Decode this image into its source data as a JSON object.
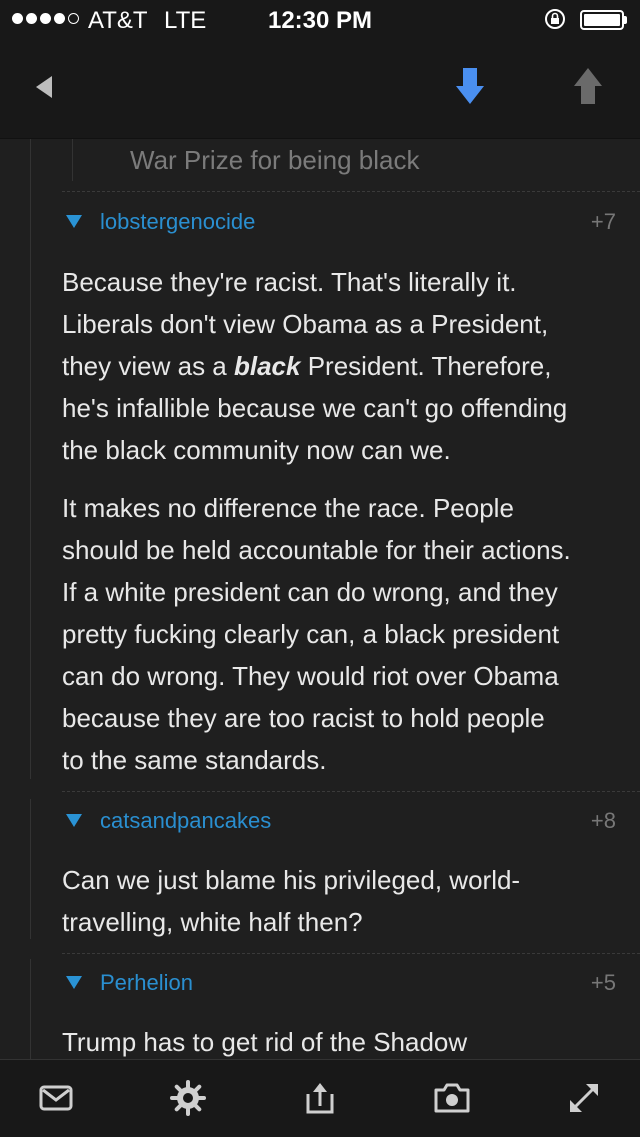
{
  "status": {
    "carrier": "AT&T",
    "network": "LTE",
    "time": "12:30 PM",
    "signal_bars": 4,
    "signal_max": 5
  },
  "nav": {
    "back_icon": "back-arrow-icon",
    "next_icon": "arrow-down-icon",
    "prev_icon": "arrow-up-icon",
    "accent": "#4a8ff0"
  },
  "previous_comment": {
    "text_tail": "War Prize for being black"
  },
  "comments": [
    {
      "username": "lobstergenocide",
      "score": "+7",
      "p1": {
        "l1": "Because they're racist. That's literally it.",
        "l2": "Liberals don't view Obama as a President,",
        "l3_pre": "they view as a ",
        "l3_em": "black",
        "l3_post": " President. Therefore,",
        "l4": "he's infallible because we can't go offending",
        "l5": "the black community now can we."
      },
      "p2": [
        "It makes no difference the race. People",
        "should be held accountable for their actions.",
        "If a white president can do wrong, and they",
        "pretty fucking clearly can, a black president",
        "can do wrong. They would riot over Obama",
        "because they are too racist to hold people",
        "to the same standards."
      ]
    },
    {
      "username": "catsandpancakes",
      "score": "+8",
      "lines": [
        "Can we just blame his privileged, world-",
        "travelling, white half then?"
      ]
    },
    {
      "username": "Perhelion",
      "score": "+5",
      "lines": [
        "Trump has to get rid of the Shadow"
      ]
    }
  ],
  "colors": {
    "background": "#1f1f1f",
    "username": "#2a8fd0",
    "score": "#777777",
    "body_text": "#e8e8e8"
  },
  "toolbar": [
    "mail-icon",
    "gear-icon",
    "share-icon",
    "camera-icon",
    "expand-icon"
  ]
}
